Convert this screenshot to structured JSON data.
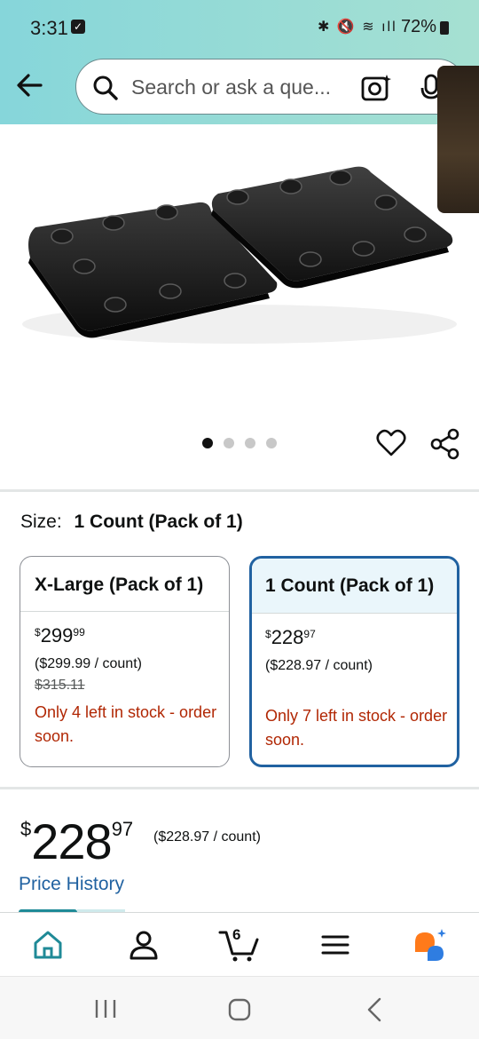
{
  "status_bar": {
    "time": "3:31",
    "battery": "72%"
  },
  "search": {
    "placeholder": "Search or ask a que..."
  },
  "product_image": {
    "image_count": 4,
    "active_index": 0
  },
  "size": {
    "label": "Size:",
    "selected": "1 Count (Pack of 1)"
  },
  "options": [
    {
      "name": "X-Large (Pack of 1)",
      "price_symbol": "$",
      "price_whole": "299",
      "price_fraction": "99",
      "unit_price": "($299.99 / count)",
      "list_price": "$315.11",
      "stock": "Only 4 left in stock - order soon."
    },
    {
      "name": "1 Count (Pack of 1)",
      "price_symbol": "$",
      "price_whole": "228",
      "price_fraction": "97",
      "unit_price": "($228.97 / count)",
      "stock": "Only 7 left in stock - order soon."
    }
  ],
  "price": {
    "symbol": "$",
    "whole": "228",
    "fraction": "97",
    "unit": "($228.97 / count)",
    "history_link": "Price History"
  },
  "bottom_nav": {
    "cart_count": "6",
    "items": [
      "home-icon",
      "account-icon",
      "cart-icon",
      "menu-icon",
      "rufus-icon"
    ]
  },
  "colors": {
    "header_start": "#86d6da",
    "header_end": "#a6e0d2",
    "link_blue": "#2162a1",
    "stock_red": "#b12704",
    "selected_bg": "#eaf6fb",
    "home_teal": "#1f8a97",
    "rufus_orange": "#ff7a1a",
    "rufus_blue": "#2f7de1"
  }
}
